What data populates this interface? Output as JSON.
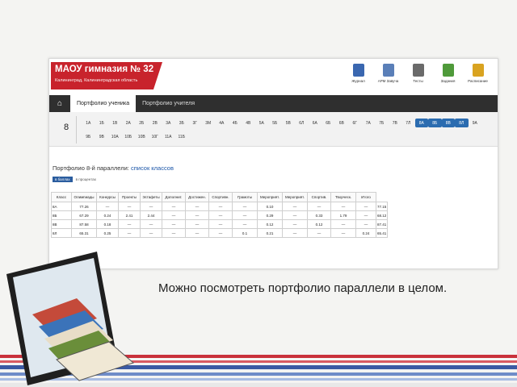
{
  "school": {
    "name": "МАОУ гимназия № 32",
    "subtitle": "Калининград, Калининградская область"
  },
  "toolbar": [
    {
      "label": "Журнал",
      "icon": "journal-icon",
      "color": "#3a67b0"
    },
    {
      "label": "АРМ Завуча",
      "icon": "workstation-icon",
      "color": "#5a7fb8"
    },
    {
      "label": "Тесты",
      "icon": "tests-icon",
      "color": "#6a6a6a"
    },
    {
      "label": "Задания",
      "icon": "tasks-icon",
      "color": "#4f9a3a"
    },
    {
      "label": "Расписание",
      "icon": "schedule-icon",
      "color": "#d9a320"
    }
  ],
  "nav": {
    "home_icon": "home-icon",
    "tabs": [
      "Портфолио ученика",
      "Портфолио учителя"
    ]
  },
  "grade": "8",
  "classes_row1": [
    "1А",
    "1Б",
    "1В",
    "2А",
    "2Б",
    "2В",
    "3А",
    "3Б",
    "3Г",
    "3М",
    "4А",
    "4Б",
    "4В",
    "5А",
    "5Б",
    "5В",
    "6Л",
    "6А",
    "6Б",
    "6В",
    "6Г",
    "7А",
    "7Б",
    "7В",
    "7Л",
    "8А",
    "8Б",
    "8В",
    "8Л",
    "9А"
  ],
  "classes_row2": [
    "9Б",
    "9В",
    "10А",
    "10Б",
    "10В",
    "10Г",
    "11А",
    "11Б"
  ],
  "highlighted_classes": [
    "8А",
    "8Б",
    "8В",
    "8Л"
  ],
  "section": {
    "title_prefix": "Портфолио 8-й параллели:",
    "title_link": "список классов",
    "tab_active": "в баллах",
    "tab_inactive": "в процентах"
  },
  "table": {
    "headers": [
      "Класс",
      "Олимпиады",
      "Конкурсы",
      "Проекты",
      "Эстафеты",
      "Дополнит.",
      "Достижен.",
      "Спортивн.",
      "Грамоты",
      "Мероприят.",
      "Мероприят.",
      "Спортив.",
      "Творческ.",
      "Итого"
    ],
    "rows": [
      [
        "8А",
        "77.26",
        "—",
        "—",
        "—",
        "—",
        "—",
        "—",
        "—",
        "0.10",
        "—",
        "—",
        "—",
        "—",
        "77.15"
      ],
      [
        "8Б",
        "67.29",
        "0.24",
        "2.41",
        "2.44",
        "—",
        "—",
        "—",
        "—",
        "0.29",
        "—",
        "0.33",
        "1.79",
        "—",
        "68.12"
      ],
      [
        "8В",
        "87.58",
        "0.18",
        "—",
        "—",
        "—",
        "—",
        "—",
        "—",
        "0.12",
        "—",
        "0.12",
        "—",
        "—",
        "87.41"
      ],
      [
        "8Л",
        "65.31",
        "0.25",
        "—",
        "—",
        "—",
        "—",
        "—",
        "0.1",
        "0.21",
        "—",
        "—",
        "—",
        "0.24",
        "65.41"
      ]
    ]
  },
  "caption": "Можно посмотреть портфолио параллели в целом."
}
